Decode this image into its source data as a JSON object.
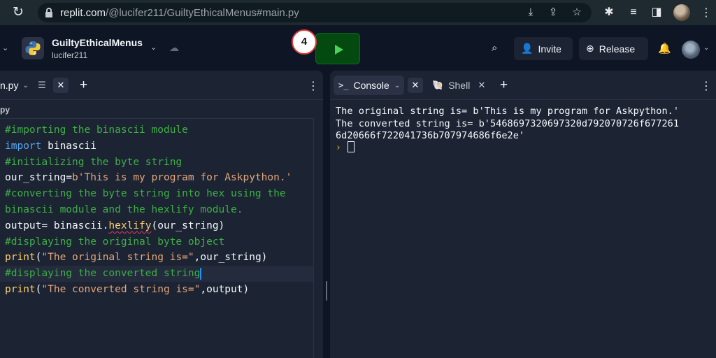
{
  "browser": {
    "url_host": "replit.com",
    "url_path": "/@lucifer211/GuiltyEthicalMenus#main.py",
    "icons": [
      "reload-icon",
      "lock-icon",
      "install-icon",
      "share-icon",
      "star-icon",
      "extensions-icon",
      "reading-list-icon",
      "sidebar-icon",
      "profile-avatar",
      "more-icon"
    ]
  },
  "header": {
    "repl_name": "GuiltyEthicalMenus",
    "owner": "lucifer211",
    "badge_number": "4",
    "invite_label": "Invite",
    "release_label": "Release",
    "accent_run": "#044a10"
  },
  "editor": {
    "tab_label": "n.py",
    "breadcrumb": "py",
    "code_lines": [
      [
        {
          "c": "cm",
          "t": "#importing the binascii module"
        }
      ],
      [
        {
          "c": "kw",
          "t": "import"
        },
        {
          "c": "tx",
          "t": " binascii"
        }
      ],
      [
        {
          "c": "cm",
          "t": "#initializing the byte string"
        }
      ],
      [
        {
          "c": "tx",
          "t": "our_string="
        },
        {
          "c": "st",
          "t": "b'This is my program for Askpython.'"
        }
      ],
      [
        {
          "c": "cm",
          "t": "#converting the byte string into hex using the"
        }
      ],
      [
        {
          "c": "cm",
          "t": "binascii module and the hexlify module."
        }
      ],
      [
        {
          "c": "tx",
          "t": "output= binascii."
        },
        {
          "c": "squig",
          "t": "hexlify"
        },
        {
          "c": "tx",
          "t": "(our_string)"
        }
      ],
      [
        {
          "c": "cm",
          "t": "#displaying the original byte object"
        }
      ],
      [
        {
          "c": "fn",
          "t": "print"
        },
        {
          "c": "tx",
          "t": "("
        },
        {
          "c": "st",
          "t": "\"The original string is=\""
        },
        {
          "c": "tx",
          "t": ",our_string)"
        }
      ],
      [
        {
          "c": "cm",
          "t": "#displaying the converted string"
        },
        {
          "c": "cursor",
          "t": ""
        }
      ],
      [
        {
          "c": "fn",
          "t": "print"
        },
        {
          "c": "tx",
          "t": "("
        },
        {
          "c": "st",
          "t": "\"The converted string is=\""
        },
        {
          "c": "tx",
          "t": ",output)"
        }
      ]
    ],
    "active_line": 9
  },
  "console": {
    "console_tab_label": "Console",
    "shell_tab_label": "Shell",
    "output": "The original string is= b'This is my program for Askpython.'\nThe converted string is= b'5468697320697320d792070726f677261\n6d20666f722041736b707974686f6e2e'",
    "prompt_symbol": "›"
  }
}
